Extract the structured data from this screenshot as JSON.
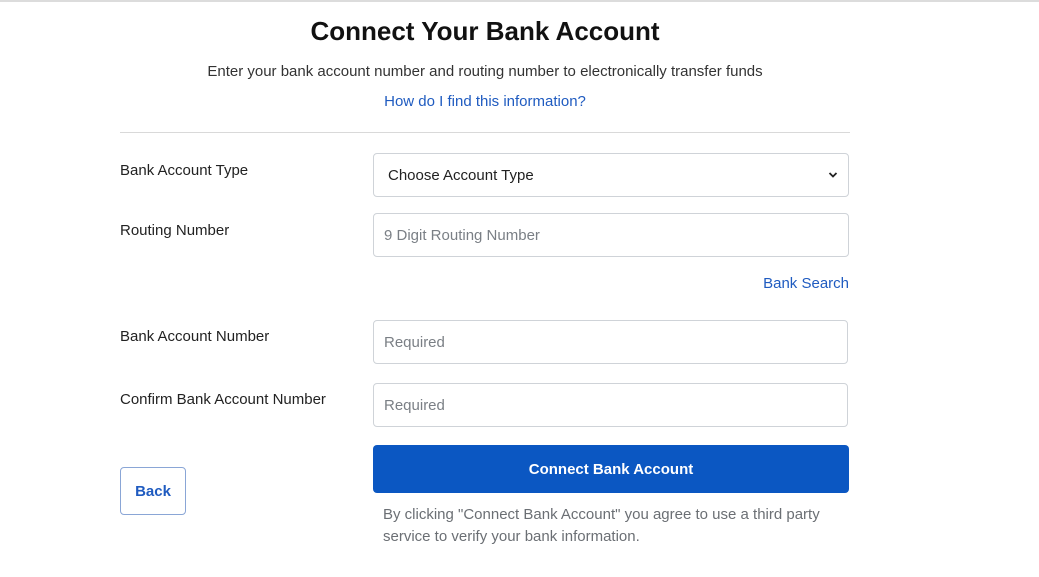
{
  "header": {
    "title": "Connect Your Bank Account",
    "subtitle": "Enter your bank account number and routing number to electronically transfer funds",
    "help_link": "How do I find this information?"
  },
  "form": {
    "account_type": {
      "label": "Bank Account Type",
      "selected": "Choose Account Type",
      "icon": "chevron-down-icon"
    },
    "routing_number": {
      "label": "Routing Number",
      "value": "",
      "placeholder": "9 Digit Routing Number"
    },
    "bank_search_link": "Bank Search",
    "account_number": {
      "label": "Bank Account Number",
      "value": "",
      "placeholder": "Required"
    },
    "confirm_account_number": {
      "label": "Confirm Bank Account Number",
      "value": "",
      "placeholder": "Required"
    }
  },
  "actions": {
    "back_label": "Back",
    "connect_label": "Connect Bank Account",
    "disclaimer": "By clicking \"Connect Bank Account\" you agree to use a third party service to verify your bank information."
  },
  "colors": {
    "primary": "#0b57c2",
    "link": "#1f5bc0"
  }
}
